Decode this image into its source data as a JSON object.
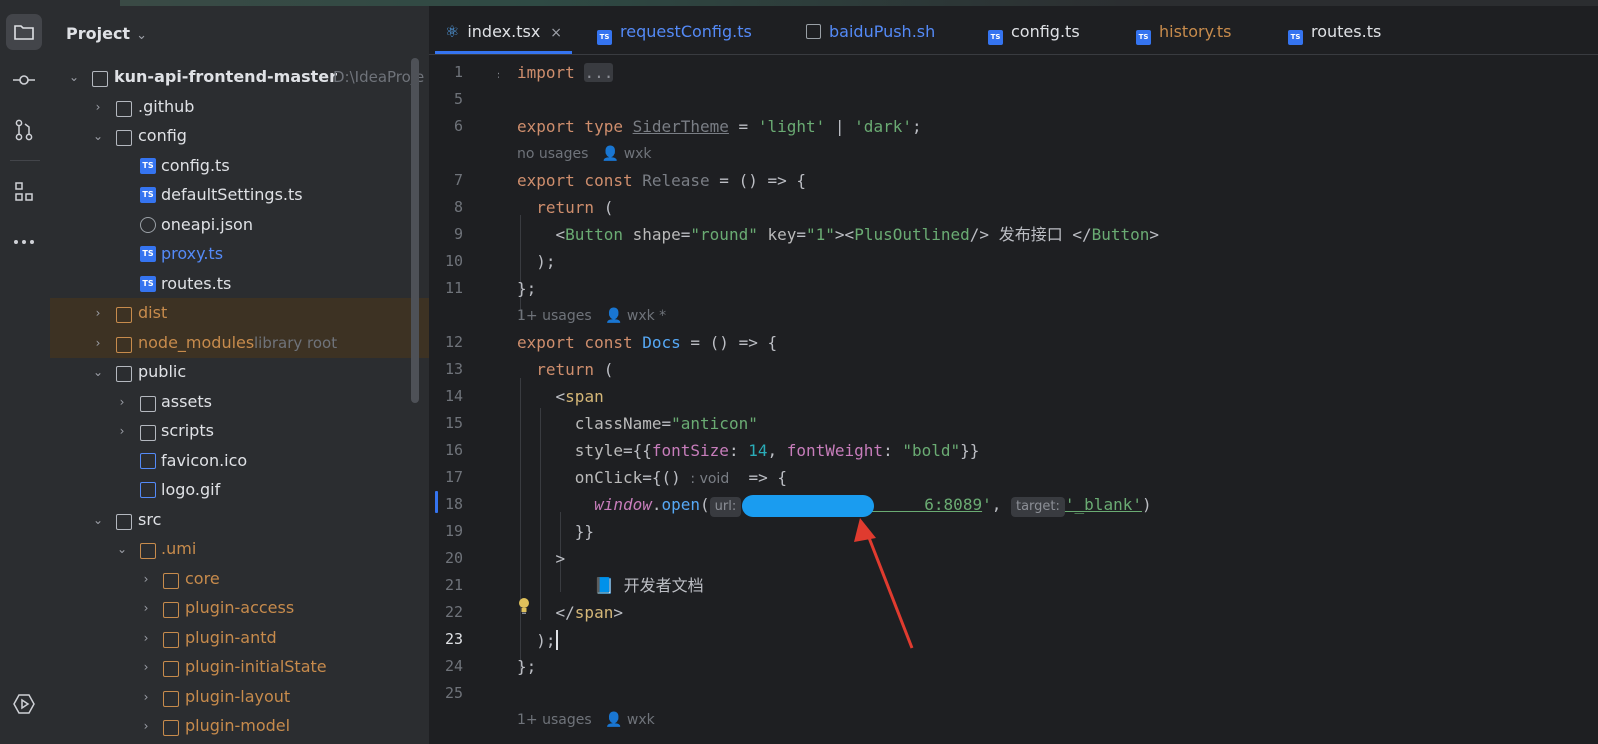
{
  "project_panel": {
    "title": "Project",
    "root_label": "kun-api-frontend-master",
    "root_path": "D:\\IdeaProje",
    "items": [
      {
        "label": ".github"
      },
      {
        "label": "config"
      },
      {
        "label": "config.ts"
      },
      {
        "label": "defaultSettings.ts"
      },
      {
        "label": "oneapi.json"
      },
      {
        "label": "proxy.ts"
      },
      {
        "label": "routes.ts"
      },
      {
        "label": "dist"
      },
      {
        "label": "node_modules",
        "note": "library root"
      },
      {
        "label": "public"
      },
      {
        "label": "assets"
      },
      {
        "label": "scripts"
      },
      {
        "label": "favicon.ico"
      },
      {
        "label": "logo.gif"
      },
      {
        "label": "src"
      },
      {
        "label": ".umi"
      },
      {
        "label": "core"
      },
      {
        "label": "plugin-access"
      },
      {
        "label": "plugin-antd"
      },
      {
        "label": "plugin-initialState"
      },
      {
        "label": "plugin-layout"
      },
      {
        "label": "plugin-model"
      }
    ]
  },
  "tabs": [
    {
      "label": "index.tsx",
      "close": "×"
    },
    {
      "label": "requestConfig.ts"
    },
    {
      "label": "baiduPush.sh"
    },
    {
      "label": "config.ts"
    },
    {
      "label": "history.ts"
    },
    {
      "label": "routes.ts"
    }
  ],
  "icons": {
    "ts_badge": "TS"
  },
  "colors": {
    "accent": "#3574f0",
    "modified_file": "#c78b4c",
    "changed_file": "#548af7",
    "highlight_row": "#3d3223"
  },
  "editor": {
    "line_numbers": [
      "1",
      "5",
      "6",
      "7",
      "8",
      "9",
      "10",
      "11",
      "12",
      "13",
      "14",
      "15",
      "16",
      "17",
      "18",
      "19",
      "20",
      "21",
      "22",
      "23",
      "24",
      "25"
    ],
    "hints": {
      "h1_usage": "no usages",
      "h1_author": "wxk",
      "h2_usage": "1+ usages",
      "h2_author": "wxk *",
      "h3_usage": "1+ usages",
      "h3_author": "wxk"
    },
    "code": {
      "l1_kw": "import",
      "l1_fold": "...",
      "l6_a": "export type ",
      "l6_b": "SiderTheme",
      "l6_c": " = ",
      "l6_d": "'light'",
      "l6_e": " | ",
      "l6_f": "'dark'",
      "l6_g": ";",
      "l7_a": "export const ",
      "l7_b": "Release",
      "l7_c": " = () => {",
      "l8_a": "  return ",
      "l8_b": "(",
      "l9_a": "    <",
      "l9_b": "Button",
      "l9_c": " shape",
      "l9_d": "=",
      "l9_e": "\"round\"",
      "l9_f": " key",
      "l9_g": "=",
      "l9_h": "\"1\"",
      "l9_i": "><",
      "l9_j": "PlusOutlined",
      "l9_k": "/> ",
      "l9_l": "发布接口",
      "l9_m": " </",
      "l9_n": "Button",
      "l9_o": ">",
      "l10": "  );",
      "l11": "};",
      "l12_a": "export const ",
      "l12_b": "Docs",
      "l12_c": " = () => {",
      "l13_a": "  return ",
      "l13_b": "(",
      "l14_a": "    <",
      "l14_b": "span",
      "l15_a": "      className",
      "l15_b": "=",
      "l15_c": "\"anticon\"",
      "l16_a": "      style",
      "l16_b": "={{",
      "l16_c": "fontSize",
      "l16_d": ": ",
      "l16_e": "14",
      "l16_f": ", ",
      "l16_g": "fontWeight",
      "l16_h": ": ",
      "l16_i": "\"bold\"",
      "l16_j": "}}",
      "l17_a": "      onClick",
      "l17_b": "={() ",
      "l17_c": ": void",
      "l17_d": "  => {",
      "l18_a": "        window",
      "l18_b": ".",
      "l18_c": "open",
      "l18_d": "(",
      "l18_e": "url:",
      "l18_f": "'",
      "l18_g": "                  6:8089",
      "l18_h": "'",
      "l18_i": ", ",
      "l18_j": "target:",
      "l18_k": "'_blank'",
      "l18_l": ")",
      "l19": "      }}",
      "l20": "    >",
      "l21_a": "        📘 ",
      "l21_b": "开发者文档",
      "l22_a": "    </",
      "l22_b": "span",
      "l22_c": ">",
      "l23": "  );",
      "l24": "};"
    }
  }
}
